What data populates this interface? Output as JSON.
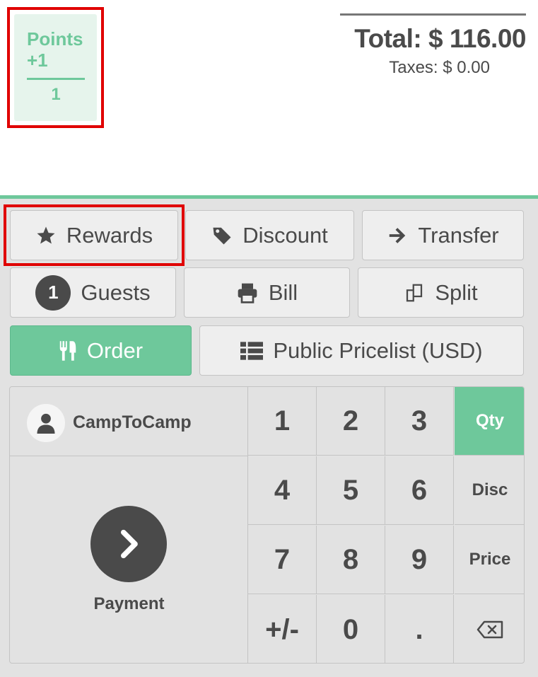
{
  "points": {
    "title": "Points",
    "delta": "+1",
    "value": "1"
  },
  "summary": {
    "total": "Total: $ 116.00",
    "taxes": "Taxes: $ 0.00"
  },
  "control_buttons": {
    "rewards": "Rewards",
    "discount": "Discount",
    "transfer": "Transfer",
    "guests_count": "1",
    "guests": "Guests",
    "bill": "Bill",
    "split": "Split",
    "order": "Order",
    "pricelist": "Public Pricelist (USD)"
  },
  "customer": {
    "name": "CampToCamp"
  },
  "payment": {
    "label": "Payment"
  },
  "numpad": {
    "k1": "1",
    "k2": "2",
    "k3": "3",
    "k4": "4",
    "k5": "5",
    "k6": "6",
    "k7": "7",
    "k8": "8",
    "k9": "9",
    "sign": "+/-",
    "k0": "0",
    "dot": ".",
    "qty": "Qty",
    "disc": "Disc",
    "price": "Price"
  },
  "colors": {
    "accent": "#6ec89b",
    "highlight": "#e00000",
    "dark": "#4a4a4a"
  },
  "icons": {
    "rewards": "star-icon",
    "discount": "tag-icon",
    "transfer": "arrow-right-icon",
    "bill": "printer-icon",
    "split": "copy-icon",
    "order": "cutlery-icon",
    "pricelist": "list-icon",
    "customer": "user-icon",
    "payment": "chevron-right-icon",
    "backspace": "backspace-icon"
  }
}
